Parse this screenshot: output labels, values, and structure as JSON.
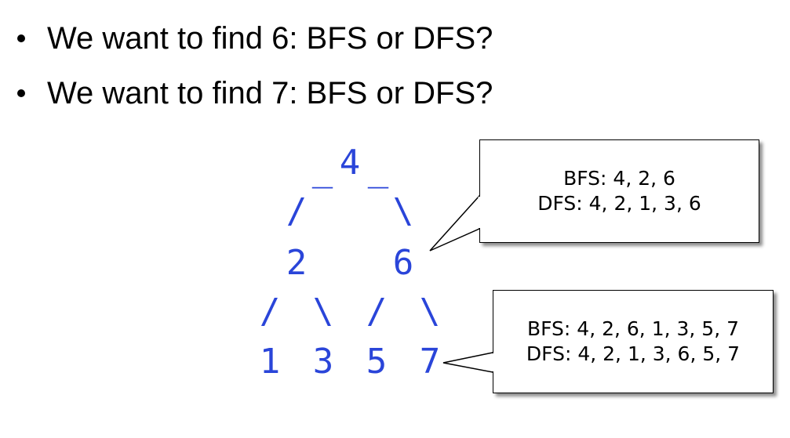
{
  "bullets": [
    {
      "text": "We want to find 6: BFS or DFS?"
    },
    {
      "text": "We want to find 7: BFS or DFS?"
    }
  ],
  "tree": {
    "node_color": "#2a45d9",
    "nodes": {
      "root": "4",
      "left": "2",
      "right": "6",
      "left_left": "1",
      "left_right": "3",
      "right_left": "5",
      "right_right": "7"
    },
    "edges": {
      "underscore": "_",
      "slash": "/",
      "backslash": "\\"
    }
  },
  "callouts": [
    {
      "line1": "BFS: 4, 2, 6",
      "line2": "DFS: 4, 2, 1, 3, 6"
    },
    {
      "line1": "BFS: 4, 2, 6, 1, 3, 5, 7",
      "line2": "DFS: 4, 2, 1, 3, 6, 5, 7"
    }
  ]
}
